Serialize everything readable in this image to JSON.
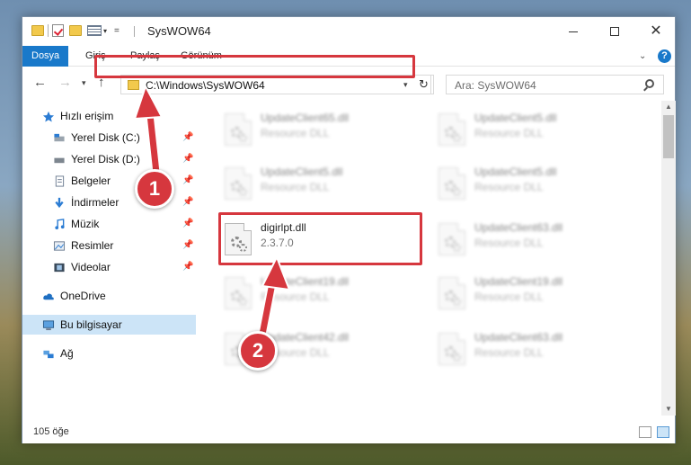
{
  "window": {
    "title": "SysWOW64"
  },
  "ribbon": {
    "tabs": [
      "Dosya",
      "Giriş",
      "Paylaş",
      "Görünüm"
    ],
    "help": "?"
  },
  "address": {
    "path": "C:\\Windows\\SysWOW64"
  },
  "search": {
    "placeholder": "Ara: SysWOW64"
  },
  "sidebar": {
    "items": [
      {
        "label": "Hızlı erişim",
        "icon": "star-icon"
      },
      {
        "label": "Yerel Disk (C:)",
        "icon": "drive-icon"
      },
      {
        "label": "Yerel Disk (D:)",
        "icon": "drive-icon"
      },
      {
        "label": "Belgeler",
        "icon": "documents-icon"
      },
      {
        "label": "İndirmeler",
        "icon": "download-icon"
      },
      {
        "label": "Müzik",
        "icon": "music-icon"
      },
      {
        "label": "Resimler",
        "icon": "pictures-icon"
      },
      {
        "label": "Videolar",
        "icon": "videos-icon"
      },
      {
        "label": "OneDrive",
        "icon": "cloud-icon"
      },
      {
        "label": "Bu bilgisayar",
        "icon": "computer-icon"
      },
      {
        "label": "Ağ",
        "icon": "network-icon"
      }
    ]
  },
  "files": {
    "left": [
      {
        "name": "UpdateClient65.dll",
        "sub": "Resource DLL"
      },
      {
        "name": "UpdateClient5.dll",
        "sub": "Resource DLL"
      },
      {
        "name": "digirlpt.dll",
        "sub": "2.3.7.0"
      },
      {
        "name": "UpdateClient19.dll",
        "sub": "Resource DLL"
      },
      {
        "name": "UpdateClient42.dll",
        "sub": "Resource DLL"
      }
    ],
    "right": [
      {
        "name": "UpdateClient5.dll",
        "sub": "Resource DLL"
      },
      {
        "name": "UpdateClient5.dll",
        "sub": "Resource DLL"
      },
      {
        "name": "UpdateClient63.dll",
        "sub": "Resource DLL"
      },
      {
        "name": "UpdateClient19.dll",
        "sub": "Resource DLL"
      },
      {
        "name": "UpdateClient63.dll",
        "sub": "Resource DLL"
      }
    ]
  },
  "status": {
    "count": "105 öğe"
  },
  "annotations": {
    "step1": "1",
    "step2": "2"
  },
  "colors": {
    "accent": "#1979ca",
    "highlight": "#d6373e",
    "selected": "#cce4f7"
  }
}
